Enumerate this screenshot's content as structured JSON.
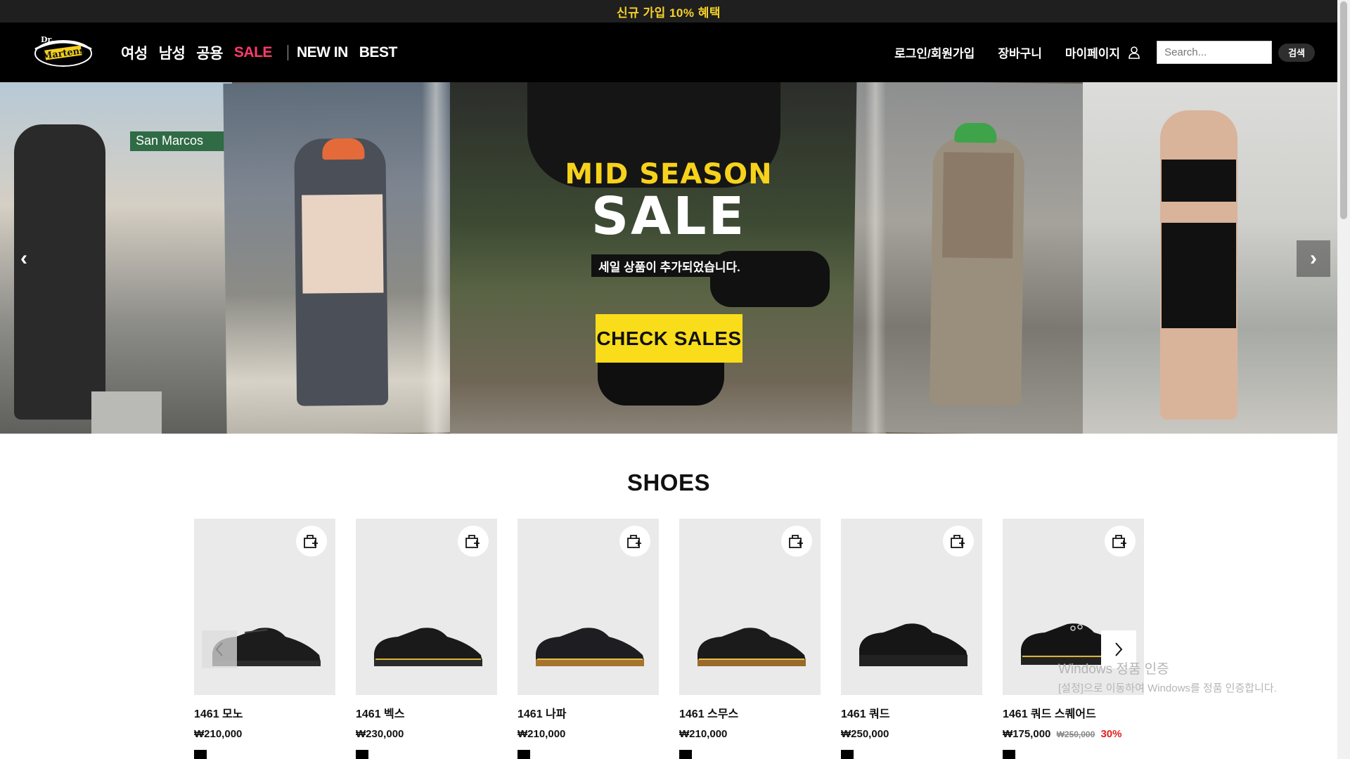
{
  "promo": {
    "text": "신규 가입 10% 혜택"
  },
  "header": {
    "logo_text": "Dr. Martens",
    "nav_left": [
      {
        "label": "여성",
        "name": "nav-women"
      },
      {
        "label": "남성",
        "name": "nav-men"
      },
      {
        "label": "공용",
        "name": "nav-unisex"
      },
      {
        "label": "SALE",
        "name": "nav-sale"
      },
      {
        "label": "NEW IN",
        "name": "nav-new-in"
      },
      {
        "label": "BEST",
        "name": "nav-best"
      }
    ],
    "nav_right": {
      "login": "로그인/회원가입",
      "cart": "장바구니",
      "mypage": "마이페이지"
    },
    "search": {
      "placeholder": "Search...",
      "button": "검색"
    }
  },
  "hero": {
    "headline": "MID SEASON",
    "headline_big": "SALE",
    "subtitle": "세일 상품이 추가되었습니다.",
    "cta": "CHECK SALES",
    "street_sign": "San Marcos",
    "prev_arrow": "‹",
    "next_arrow": "›"
  },
  "shoes": {
    "title": "SHOES",
    "products": [
      {
        "name": "1461 모노",
        "price": "₩210,000"
      },
      {
        "name": "1461 벡스",
        "price": "₩230,000"
      },
      {
        "name": "1461 나파",
        "price": "₩210,000"
      },
      {
        "name": "1461 스무스",
        "price": "₩210,000"
      },
      {
        "name": "1461 쿼드",
        "price": "₩250,000"
      },
      {
        "name": "1461 쿼드 스퀘어드",
        "price": "₩175,000",
        "original_price": "₩250,000",
        "discount": "30%"
      }
    ]
  },
  "watermark": {
    "line1": "Windows 정품 인증",
    "line2": "[설정]으로 이동하여 Windows를 정품 인증합니다."
  },
  "colors": {
    "promo_text": "#f5d12a",
    "sale_nav": "#ff3b6b",
    "cta_bg": "#f9dc1a",
    "discount": "#e02020"
  }
}
